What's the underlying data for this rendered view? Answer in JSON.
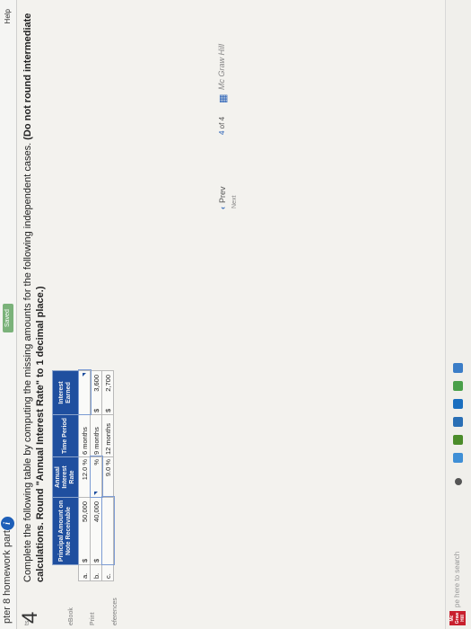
{
  "header": {
    "title": "pter 8 homework part I",
    "info_icon": "i",
    "saved": "Saved",
    "help": "Help"
  },
  "sidebar": {
    "items": [
      "ts",
      "eBook",
      "Print",
      "eferences"
    ]
  },
  "question": {
    "number": "4",
    "text_plain": "Complete the following table by computing the missing amounts for the following independent cases.",
    "text_bold": "(Do not round intermediate calculations. Round \"Annual Interest Rate\" to 1 decimal place.)"
  },
  "table": {
    "headers": {
      "principal": "Principal Amount on Note Receivable",
      "rate": "Annual Interest Rate",
      "time": "Time Period",
      "interest": "Interest Earned"
    },
    "rows": [
      {
        "label": "a.",
        "principal_prefix": "$",
        "principal": "50,000",
        "rate": "12.0",
        "rate_suffix": "%",
        "time": "6 months",
        "interest_prefix": "",
        "interest": ""
      },
      {
        "label": "b.",
        "principal_prefix": "$",
        "principal": "40,000",
        "rate": "",
        "rate_suffix": "%",
        "time": "9 months",
        "interest_prefix": "$",
        "interest": "3,600"
      },
      {
        "label": "c.",
        "principal_prefix": "",
        "principal": "",
        "rate": "9.0",
        "rate_suffix": "%",
        "time": "12 months",
        "interest_prefix": "$",
        "interest": "2,700"
      }
    ]
  },
  "nav": {
    "prev": "Prev",
    "page_current": "4",
    "page_of": "of 4",
    "next": "Next",
    "brand": "Mc Graw Hill"
  },
  "taskbar": {
    "search": "pe here to search",
    "logo_text": "Mc Graw Hill"
  }
}
